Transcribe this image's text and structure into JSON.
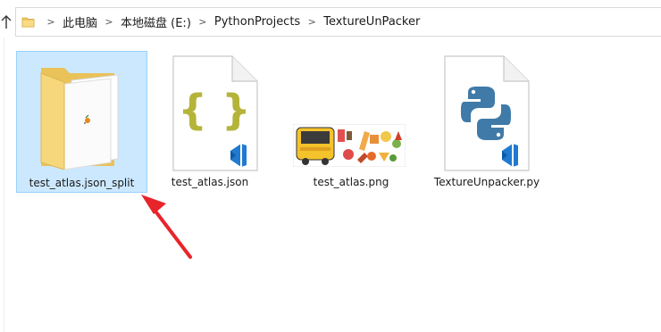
{
  "breadcrumb": {
    "items": [
      "此电脑",
      "本地磁盘 (E:)",
      "PythonProjects",
      "TextureUnPacker"
    ]
  },
  "files": [
    {
      "name": "test_atlas.json_split",
      "type": "folder",
      "selected": true
    },
    {
      "name": "test_atlas.json",
      "type": "json-file",
      "selected": false
    },
    {
      "name": "test_atlas.png",
      "type": "png-image",
      "selected": false
    },
    {
      "name": "TextureUnpacker.py",
      "type": "python-file",
      "selected": false
    }
  ],
  "colors": {
    "selection_bg": "#cce8ff",
    "selection_border": "#99d1ff",
    "arrow": "#e8242b",
    "json_brace": "#b5b43a",
    "vscode_blue": "#1f7ad0",
    "python_blue": "#3f7aa8"
  }
}
